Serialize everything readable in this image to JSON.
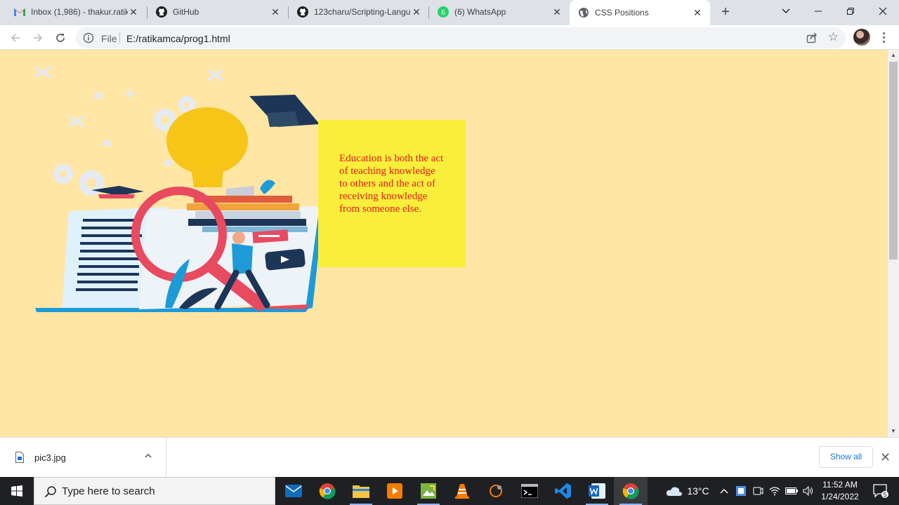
{
  "browser": {
    "tabs": [
      {
        "title": "Inbox (1,986) - thakur.ratik",
        "icon": "gmail-icon"
      },
      {
        "title": "GitHub",
        "icon": "github-icon"
      },
      {
        "title": "123charu/Scripting-Langu",
        "icon": "github-icon"
      },
      {
        "title": "(6) WhatsApp",
        "icon": "whatsapp-icon",
        "badge": "6"
      },
      {
        "title": "CSS Positions",
        "icon": "globe-icon",
        "active": true
      }
    ],
    "address": {
      "scheme_label": "File",
      "url": "E:/ratikamca/prog1.html"
    }
  },
  "page": {
    "background": "#ffe6a4",
    "box_color": "#f9ef3b",
    "text_color": "#e8181e",
    "paragraph": "Education is both the act of teaching knowledge to others and the act of receiving knowledge from someone else.",
    "image": "education illustration: laptop, light bulb, graduation cap, books, magnifier"
  },
  "downloads": {
    "file_name": "pic3.jpg",
    "show_all_label": "Show all"
  },
  "taskbar": {
    "search_placeholder": "Type here to search",
    "weather": "13°C",
    "time": "11:52 AM",
    "date": "1/24/2022",
    "notification_count": "5"
  }
}
